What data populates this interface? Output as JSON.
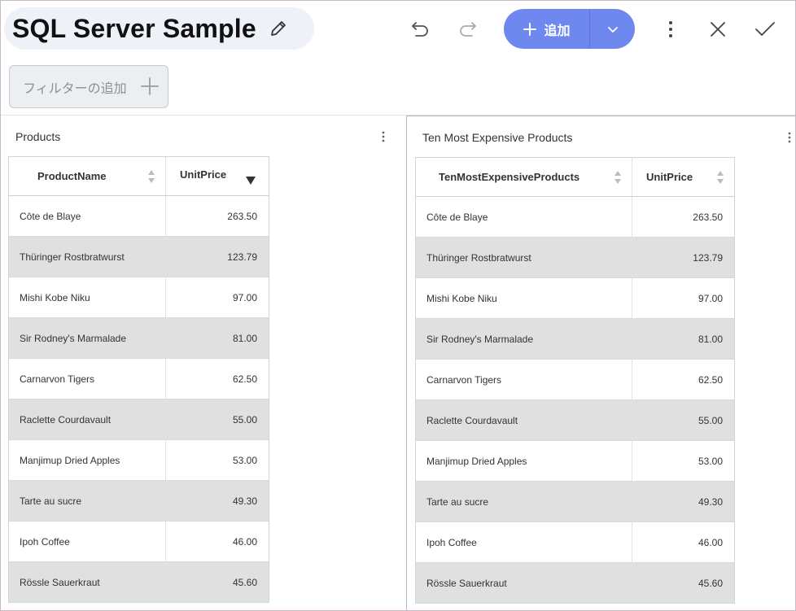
{
  "header": {
    "title": "SQL Server Sample",
    "add_label": "追加"
  },
  "filter": {
    "label": "フィルターの追加"
  },
  "colors": {
    "accent": "#6f88f0",
    "row_alt": "#e0e0e0",
    "title_pill": "#eef1f8"
  },
  "icons": [
    "pencil-icon",
    "undo-icon",
    "redo-icon",
    "plus-icon",
    "chevron-down-icon",
    "more-vertical-icon",
    "close-icon",
    "check-icon",
    "sort-icon",
    "sort-desc-icon"
  ],
  "panels": [
    {
      "title": "Products",
      "columns": [
        "ProductName",
        "UnitPrice"
      ],
      "sorted_column": "UnitPrice",
      "sort_direction": "descending",
      "rows": [
        [
          "Côte de Blaye",
          "263.50"
        ],
        [
          "Thüringer Rostbratwurst",
          "123.79"
        ],
        [
          "Mishi Kobe Niku",
          "97.00"
        ],
        [
          "Sir Rodney's Marmalade",
          "81.00"
        ],
        [
          "Carnarvon Tigers",
          "62.50"
        ],
        [
          "Raclette Courdavault",
          "55.00"
        ],
        [
          "Manjimup Dried Apples",
          "53.00"
        ],
        [
          "Tarte au sucre",
          "49.30"
        ],
        [
          "Ipoh Coffee",
          "46.00"
        ],
        [
          "Rössle Sauerkraut",
          "45.60"
        ]
      ]
    },
    {
      "title": "Ten Most Expensive Products",
      "columns": [
        "TenMostExpensiveProducts",
        "UnitPrice"
      ],
      "rows": [
        [
          "Côte de Blaye",
          "263.50"
        ],
        [
          "Thüringer Rostbratwurst",
          "123.79"
        ],
        [
          "Mishi Kobe Niku",
          "97.00"
        ],
        [
          "Sir Rodney's Marmalade",
          "81.00"
        ],
        [
          "Carnarvon Tigers",
          "62.50"
        ],
        [
          "Raclette Courdavault",
          "55.00"
        ],
        [
          "Manjimup Dried Apples",
          "53.00"
        ],
        [
          "Tarte au sucre",
          "49.30"
        ],
        [
          "Ipoh Coffee",
          "46.00"
        ],
        [
          "Rössle Sauerkraut",
          "45.60"
        ]
      ]
    }
  ]
}
